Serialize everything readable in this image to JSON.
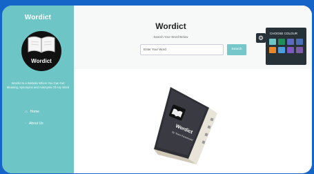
{
  "sidebar": {
    "brand": "Wordict",
    "logo_text": "Wordict",
    "description": "Wordict Is a Website Where You Can Get Meaning, Synonyms and Antonyms Of Any Word",
    "items": [
      {
        "label": "Home",
        "icon": "home-icon"
      },
      {
        "label": "About Us",
        "icon": "info-icon"
      }
    ]
  },
  "main": {
    "title": "Wordict",
    "subtitle": "Search Your Word Below",
    "search": {
      "placeholder": "Enter Your Word",
      "button_label": "Search"
    },
    "book": {
      "title": "Wordict",
      "byline": "By Team Punemoner"
    }
  },
  "color_panel": {
    "title": "CHOOSE COLOUR",
    "swatches": [
      "#6ec5c5",
      "#1f8e5a",
      "#5c6bc0",
      "#4a6fb5",
      "#e6862d",
      "#4c9fdf",
      "#7e57c2",
      "#7b5ea7"
    ]
  }
}
